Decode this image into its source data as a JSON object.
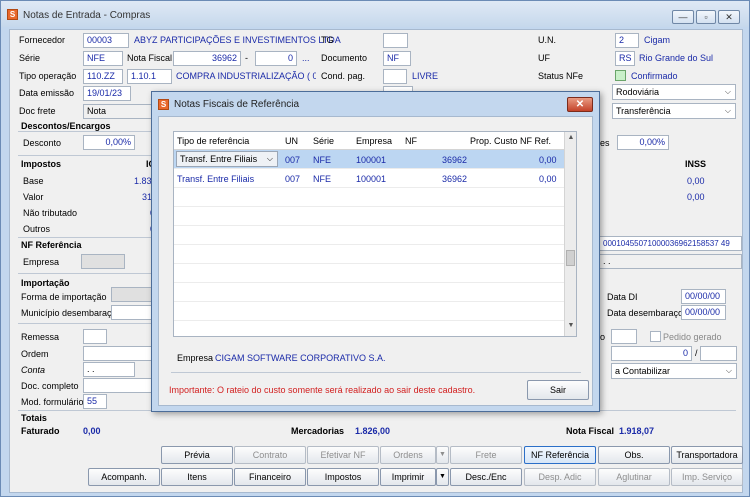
{
  "window": {
    "title": "Notas de Entrada - Compras",
    "btn_min": "—",
    "btn_max": "▫",
    "btn_close": "✕"
  },
  "form": {
    "fornecedor_label": "Fornecedor",
    "fornecedor_code": "00003",
    "fornecedor_name": "ABYZ PARTICIPAÇÕES E INVESTIMENTOS LTDA",
    "tg_label": "TG",
    "tg_value": "",
    "un_label": "U.N.",
    "un_code": "2",
    "un_name": "Cigam",
    "serie_label": "Série",
    "serie_value": "NFE",
    "nota_fiscal_label": "Nota Fiscal",
    "nota_fiscal_value": "36962",
    "nota_fiscal_dash": "-",
    "nota_fiscal_seq": "0",
    "nota_fiscal_ellipsis": "...",
    "documento_label": "Documento",
    "documento_value": "NF",
    "uf_label": "UF",
    "uf_code": "RS",
    "uf_name": "Rio Grande do Sul",
    "tipo_operacao_label": "Tipo operação",
    "tipo_operacao_code": "110.ZZ",
    "tipo_operacao_cfop": "1.10.1",
    "tipo_operacao_desc": "COMPRA INDUSTRIALIZAÇÃO ( 0 ve",
    "cond_pag_label": "Cond. pag.",
    "cond_pag_code": "",
    "cond_pag_desc": "LIVRE",
    "status_nfe_label": "Status NFe",
    "status_nfe_value": "Confirmado",
    "data_emissao_label": "Data emissão",
    "data_emissao_value": "19/01/23",
    "transporte_value": "Rodoviária",
    "doc_frete_label": "Doc frete",
    "doc_frete_value": "Nota",
    "tipo_value": "Transferência",
    "descontos_header": "Descontos/Encargos",
    "desconto_label": "Desconto",
    "desconto_value": "0,00%",
    "right_pct_label": "es",
    "right_pct_value": "0,00%",
    "impostos_header": "Impostos",
    "ic_header": "IC",
    "base_label": "Base",
    "base_value": "1.83",
    "valor_label": "Valor",
    "valor_value": "31",
    "nao_tributado_label": "Não tributado",
    "nao_tributado_value": "0",
    "outros_label": "Outros",
    "outros_value": "0",
    "inss_header": "INSS",
    "inss_value1": "0,00",
    "inss_value2": "0,00",
    "nf_referencia_header": "NF Referência",
    "empresa_label": "Empresa",
    "chave_value": "00010455071000036962158537 49",
    "chave_dots": ".   .",
    "importacao_header": "Importação",
    "forma_importacao_label": "Forma de importação",
    "municipio_label": "Município desembaraço",
    "data_di_label": "Data DI",
    "data_di_value": "00/00/00",
    "data_desemb_label": "Data desembaraço",
    "data_desemb_value": "00/00/00",
    "remessa_label": "Remessa",
    "ordem_label": "Ordem",
    "conta_label": "Conta",
    "conta_value": ". .",
    "doc_completo_label": "Doc. completo",
    "mod_formulario_label": "Mod. formulário",
    "mod_formulario_value": "55",
    "pedido_gerado_label": "Pedido gerado",
    "o_label": "o",
    "zero_value": "0",
    "slash": "/",
    "contabilizar_value": "a Contabilizar",
    "totais_header": "Totais",
    "faturado_label": "Faturado",
    "faturado_value": "0,00",
    "mercadorias_label": "Mercadorias",
    "mercadorias_value": "1.826,00",
    "nota_fiscal_total_label": "Nota Fiscal",
    "nota_fiscal_total_value": "1.918,07"
  },
  "buttons_row1": [
    "Prévia",
    "Contrato",
    "Efetivar NF",
    "Ordens",
    "Frete",
    "NF Referência",
    "Obs.",
    "Transportadora"
  ],
  "buttons_row2": [
    "Acompanh.",
    "Itens",
    "Financeiro",
    "Impostos",
    "Imprimir",
    "Desc./Enc",
    "Desp. Adic",
    "Aglutinar",
    "Imp. Serviço"
  ],
  "modal": {
    "title": "Notas Fiscais de Referência",
    "columns": [
      "Tipo de referência",
      "UN",
      "Série",
      "Empresa",
      "NF",
      "Prop. Custo NF Ref."
    ],
    "rows": [
      {
        "tipo": "Transf. Entre Filiais",
        "un": "007",
        "serie": "NFE",
        "empresa": "100001",
        "nf": "36962",
        "prop": "0,00"
      },
      {
        "tipo": "Transf. Entre Filiais",
        "un": "007",
        "serie": "NFE",
        "empresa": "100001",
        "nf": "36962",
        "prop": "0,00"
      }
    ],
    "empresa_label": "Empresa",
    "empresa_value": "CIGAM SOFTWARE CORPORATIVO S.A.",
    "warning": "Importante: O rateio do custo somente será realizado ao sair deste cadastro.",
    "sair_label": "Sair"
  },
  "colors": {
    "accent_blue": "#1a2aa8",
    "warning_red": "#d21f1f",
    "title_bg": "#c3d7ee",
    "selected_row": "#bcd6f2",
    "status_green": "#c9f0c9"
  },
  "icons": [
    "app-icon",
    "minimize-icon",
    "maximize-icon",
    "close-icon",
    "chevron-down-icon",
    "scroll-up-icon",
    "scroll-down-icon"
  ]
}
